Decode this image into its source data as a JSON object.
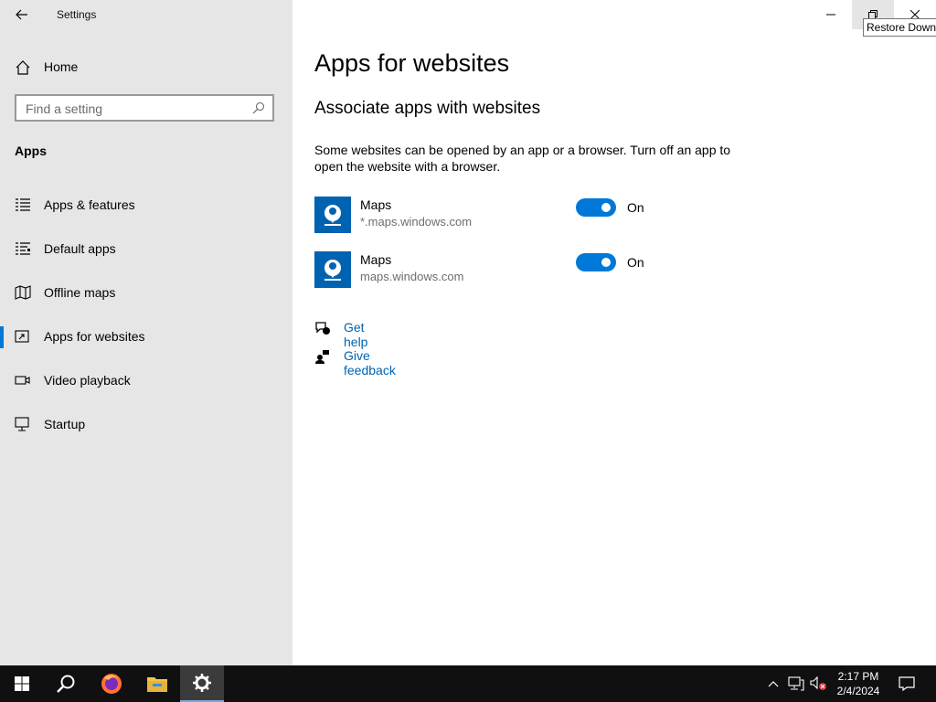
{
  "window": {
    "title": "Settings",
    "tooltip": "Restore Down",
    "controls": [
      "minimize-icon",
      "restore-icon",
      "close-icon"
    ]
  },
  "sidebar": {
    "home_label": "Home",
    "search_placeholder": "Find a setting",
    "section_title": "Apps",
    "items": [
      {
        "label": "Apps & features",
        "icon": "apps-features-icon"
      },
      {
        "label": "Default apps",
        "icon": "default-apps-icon"
      },
      {
        "label": "Offline maps",
        "icon": "offline-maps-icon"
      },
      {
        "label": "Apps for websites",
        "icon": "apps-websites-icon",
        "active": true
      },
      {
        "label": "Video playback",
        "icon": "video-playback-icon"
      },
      {
        "label": "Startup",
        "icon": "startup-icon"
      }
    ]
  },
  "main": {
    "title": "Apps for websites",
    "subtitle": "Associate apps with websites",
    "description": "Some websites can be opened by an app or a browser.  Turn off an app to open the website with a browser.",
    "apps": [
      {
        "name": "Maps",
        "url": "*.maps.windows.com",
        "state": "On",
        "enabled": true
      },
      {
        "name": "Maps",
        "url": "maps.windows.com",
        "state": "On",
        "enabled": true
      }
    ],
    "links": [
      {
        "label": "Get help",
        "icon": "help-icon"
      },
      {
        "label": "Give feedback",
        "icon": "feedback-icon"
      }
    ]
  },
  "taskbar": {
    "apps": [
      "start-icon",
      "search-icon",
      "firefox-icon",
      "file-explorer-icon",
      "settings-icon"
    ],
    "time": "2:17 PM",
    "date": "2/4/2024"
  },
  "colors": {
    "accent": "#0078d7",
    "link": "#0063b1",
    "sidebar_bg": "#e6e6e6",
    "taskbar_bg": "#101010"
  }
}
